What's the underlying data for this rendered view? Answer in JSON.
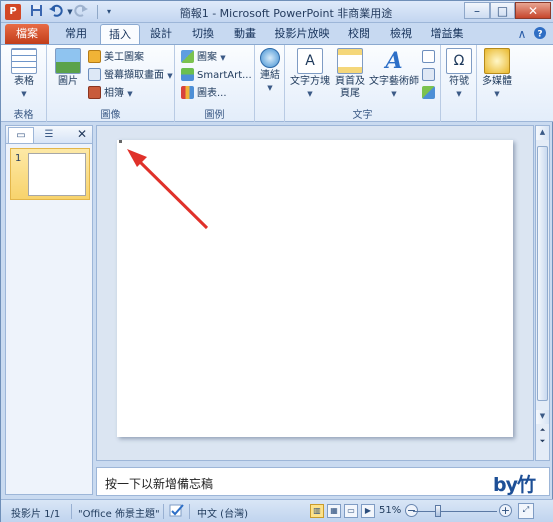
{
  "window": {
    "title": "簡報1 - Microsoft PowerPoint 非商業用途",
    "app_icon": "P",
    "controls": {
      "minimize": "–",
      "maximize": "□",
      "close": "✕"
    }
  },
  "qat": {
    "save_icon": "save-icon",
    "undo_icon": "undo-icon",
    "redo_icon": "redo-icon",
    "customize_icon": "customize-qat-icon"
  },
  "tabs": [
    {
      "label": "檔案"
    },
    {
      "label": "常用"
    },
    {
      "label": "插入"
    },
    {
      "label": "設計"
    },
    {
      "label": "切換"
    },
    {
      "label": "動畫"
    },
    {
      "label": "投影片放映"
    },
    {
      "label": "校閱"
    },
    {
      "label": "檢視"
    },
    {
      "label": "增益集"
    }
  ],
  "active_tab": "插入",
  "ribbon": {
    "tables": {
      "label": "表格",
      "table_button": "表格"
    },
    "images": {
      "label": "圖像",
      "picture": "圖片",
      "clip_art": "美工圖案",
      "screenshot": "螢幕擷取畫面",
      "photo_album": "相簿"
    },
    "illustrations": {
      "label": "圖例",
      "shapes": "圖案",
      "smartart": "SmartArt...",
      "chart": "圖表..."
    },
    "links": {
      "hyperlink": "連結"
    },
    "text": {
      "label": "文字",
      "text_box": "文字方塊",
      "header_footer_line1": "頁首及",
      "header_footer_line2": "頁尾",
      "wordart": "文字藝術師"
    },
    "symbols": {
      "symbol": "符號"
    },
    "media": {
      "media": "多媒體"
    }
  },
  "left_pane": {
    "slide_number": "1",
    "close": "✕"
  },
  "notes": {
    "placeholder": "按一下以新增備忘稿",
    "logo": "by竹"
  },
  "status": {
    "slide_indicator": "投影片 1/1",
    "theme": "\"Office 佈景主題\"",
    "language": "中文 (台灣)",
    "zoom": "51%",
    "zoom_level": 51,
    "zoom_minus": "−",
    "zoom_plus": "+"
  },
  "colors": {
    "file_tab": "#c13d1a",
    "arrow": "#e0312a",
    "thumbnail_highlight": "#f8d36c"
  }
}
